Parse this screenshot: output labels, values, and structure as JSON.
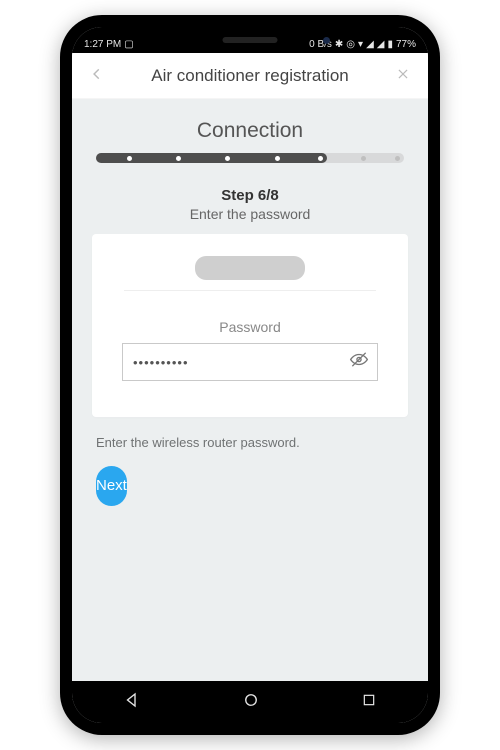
{
  "status": {
    "time": "1:27 PM",
    "net": "0 B/s",
    "battery": "77%"
  },
  "header": {
    "title": "Air conditioner registration"
  },
  "section": {
    "title": "Connection"
  },
  "progress": {
    "current": 6,
    "total": 8,
    "fill_percent": 75
  },
  "step": {
    "label": "Step 6/8",
    "subtitle": "Enter the password"
  },
  "form": {
    "password_label": "Password",
    "password_value": "••••••••••"
  },
  "hint": "Enter the wireless router password.",
  "actions": {
    "next": "Next"
  },
  "colors": {
    "primary": "#2aa7ef"
  }
}
